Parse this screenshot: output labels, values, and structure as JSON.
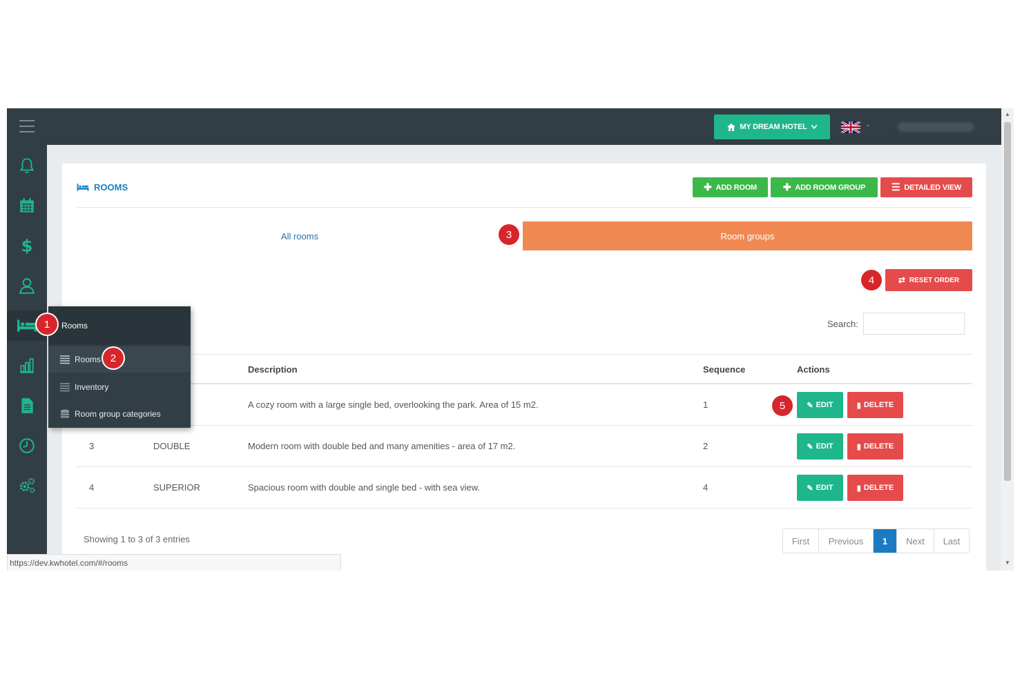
{
  "header": {
    "hotel_button_label": "MY DREAM HOTEL",
    "language": "English (UK)"
  },
  "sidebar": {
    "items": [
      {
        "name": "notifications",
        "icon": "bell-icon"
      },
      {
        "name": "calendar",
        "icon": "calendar-icon"
      },
      {
        "name": "finance",
        "icon": "dollar-icon"
      },
      {
        "name": "guests",
        "icon": "user-icon"
      },
      {
        "name": "rooms",
        "icon": "bed-icon",
        "active": true
      },
      {
        "name": "reports",
        "icon": "bar-chart-icon"
      },
      {
        "name": "documents",
        "icon": "document-icon"
      },
      {
        "name": "history",
        "icon": "clock-icon"
      },
      {
        "name": "settings",
        "icon": "gears-icon"
      }
    ],
    "flyout": {
      "title": "Rooms",
      "items": [
        {
          "label": "Rooms",
          "icon": "list-icon"
        },
        {
          "label": "Inventory",
          "icon": "list-icon"
        },
        {
          "label": "Room group categories",
          "icon": "database-icon"
        }
      ]
    }
  },
  "page": {
    "title": "ROOMS",
    "buttons": {
      "add_room": "ADD ROOM",
      "add_room_group": "ADD ROOM GROUP",
      "detailed_view": "DETAILED VIEW"
    },
    "tabs": {
      "all_rooms": "All rooms",
      "room_groups": "Room groups"
    },
    "reset_order": "RESET ORDER",
    "search": {
      "label": "Search:",
      "value": ""
    },
    "table": {
      "columns": {
        "description": "Description",
        "sequence": "Sequence",
        "actions": "Actions"
      },
      "rows": [
        {
          "id": "",
          "name": "",
          "description": "A cozy room with a large single bed, overlooking the park. Area of 15 m2.",
          "sequence": "1"
        },
        {
          "id": "3",
          "name": "DOUBLE",
          "description": "Modern room with double bed and many amenities - area of 17 m2.",
          "sequence": "2"
        },
        {
          "id": "4",
          "name": "SUPERIOR",
          "description": "Spacious room with double and single bed - with sea view.",
          "sequence": "4"
        }
      ],
      "edit_label": "EDIT",
      "delete_label": "DELETE"
    },
    "showing": "Showing 1 to 3 of 3 entries",
    "pagination": {
      "first": "First",
      "previous": "Previous",
      "current": "1",
      "next": "Next",
      "last": "Last"
    }
  },
  "markers": [
    "1",
    "2",
    "3",
    "4",
    "5"
  ],
  "status_url": "https://dev.kwhotel.com/#/rooms",
  "colors": {
    "sidebar": "#323e45",
    "accent_green": "#1fb68c",
    "danger_red": "#e54b4b",
    "add_green": "#3cb84a",
    "tab_orange": "#f08852",
    "title_blue": "#1a82c4",
    "marker_red": "#d7262b"
  }
}
